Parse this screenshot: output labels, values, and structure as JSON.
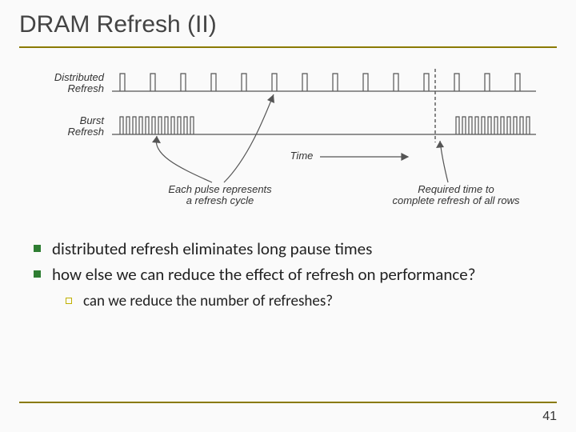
{
  "title": "DRAM Refresh (II)",
  "diagram": {
    "label_distributed": "Distributed\nRefresh",
    "label_burst": "Burst\nRefresh",
    "label_time": "Time",
    "label_pulse": "Each pulse represents\na refresh cycle",
    "label_required": "Required time to\ncomplete refresh of all rows"
  },
  "bullets": [
    "distributed refresh eliminates long pause times",
    "how else we can reduce the effect of refresh on performance?"
  ],
  "sub_bullets": [
    "can we reduce the number of refreshes?"
  ],
  "page_number": "41"
}
